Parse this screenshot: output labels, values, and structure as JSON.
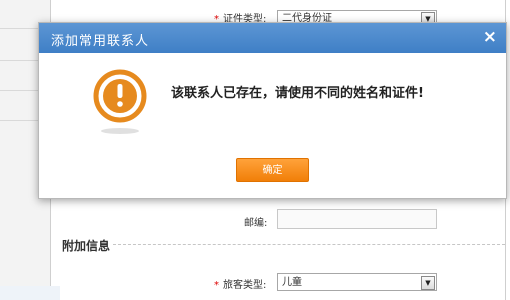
{
  "form": {
    "id_type_label": "证件类型:",
    "id_type_value": "二代身份证",
    "postcode_label": "邮编:",
    "postcode_value": "",
    "extra_section_title": "附加信息",
    "passenger_type_label": "旅客类型:",
    "passenger_type_value": "儿童",
    "required_mark": "*"
  },
  "dialog": {
    "title": "添加常用联系人",
    "close_glyph": "×",
    "message": "该联系人已存在，请使用不同的姓名和证件!",
    "ok_label": "确定"
  },
  "colors": {
    "dialog_header": "#4a88cc",
    "warn_icon": "#e68a1e",
    "ok_button": "#f58a12"
  },
  "icons": {
    "warning": "warning-exclamation-icon",
    "close": "close-icon",
    "dropdown": "chevron-down-icon"
  }
}
